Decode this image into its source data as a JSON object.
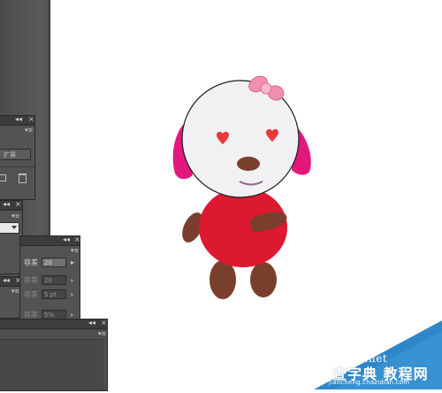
{
  "panels": {
    "close_glyph": "×",
    "collapse_glyph": "◂◂",
    "menu_glyph": "▾≡",
    "p1": {
      "button_label": "扩展"
    },
    "p3": {
      "tolerance_label_1": "容差",
      "tolerance_value_1": "20",
      "tolerance_label_2": "容差",
      "tolerance_value_2": "20",
      "tolerance_label_3": "容差",
      "tolerance_value_3": "5 pt",
      "tolerance_label_4": "容差",
      "tolerance_value_4": "5%"
    }
  },
  "watermark": {
    "site": "jb51.net",
    "title": "查字典 教程网",
    "url": "jiaocheng.chazidian.com"
  },
  "colors": {
    "panel_bg": "#535353",
    "canvas_bg": "#ffffff",
    "bear_body": "#dd1930",
    "bear_limbs": "#7a3f2c",
    "bear_ears": "#e2187d",
    "bear_face": "#f1f1f3",
    "bow": "#f08fb0"
  }
}
